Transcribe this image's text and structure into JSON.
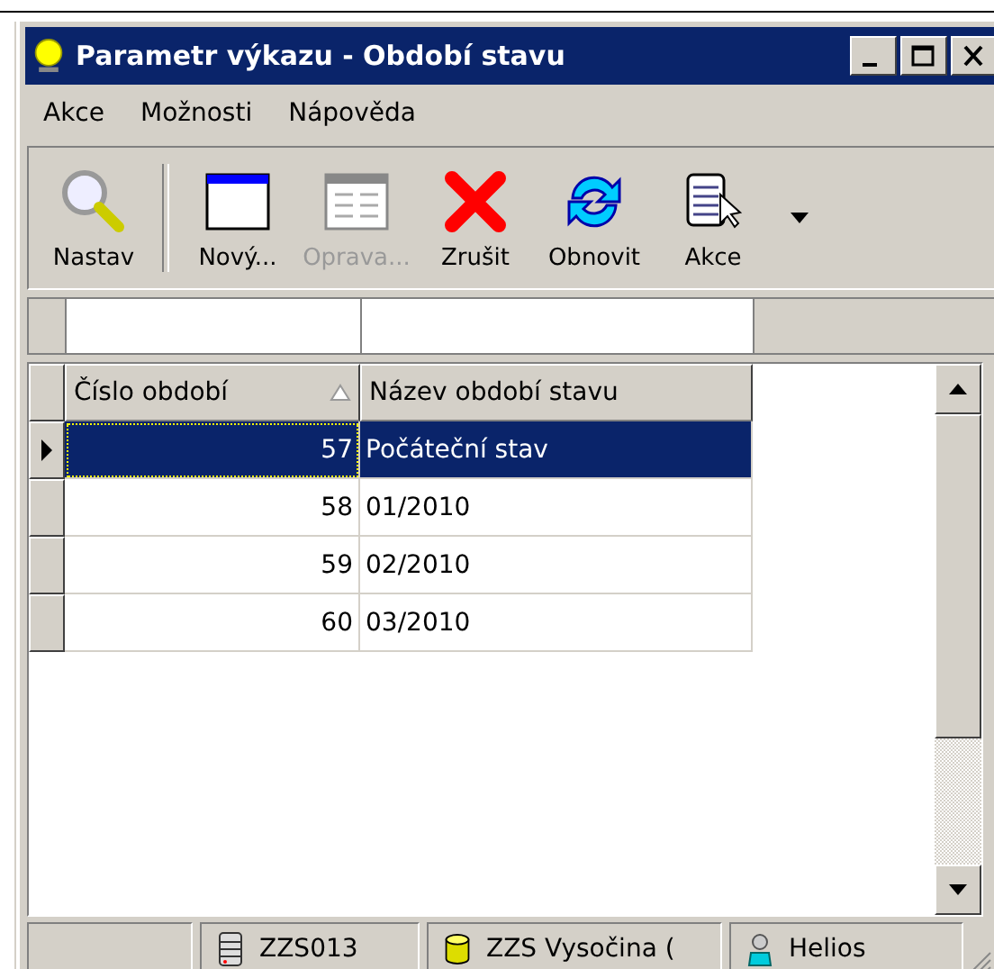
{
  "window": {
    "title": "Parametr výkazu - Období stavu"
  },
  "menu": [
    {
      "label": "Akce"
    },
    {
      "label": "Možnosti"
    },
    {
      "label": "Nápověda"
    }
  ],
  "toolbar": [
    {
      "kind": "search",
      "label": "Nastav",
      "disabled": false
    },
    {
      "kind": "new",
      "label": "Nový...",
      "disabled": false
    },
    {
      "kind": "edit",
      "label": "Oprava...",
      "disabled": true
    },
    {
      "kind": "delete",
      "label": "Zrušit",
      "disabled": false
    },
    {
      "kind": "refresh",
      "label": "Obnovit",
      "disabled": false
    },
    {
      "kind": "actions",
      "label": "Akce",
      "disabled": false
    }
  ],
  "grid": {
    "columns": [
      {
        "label": "Číslo období",
        "sorted": true
      },
      {
        "label": "Název období stavu",
        "sorted": false
      }
    ],
    "rows": [
      {
        "number": "57",
        "name": "Počáteční stav",
        "selected": true
      },
      {
        "number": "58",
        "name": "01/2010",
        "selected": false
      },
      {
        "number": "59",
        "name": "02/2010",
        "selected": false
      },
      {
        "number": "60",
        "name": "03/2010",
        "selected": false
      }
    ]
  },
  "status_bar": [
    {
      "kind": "empty"
    },
    {
      "kind": "server",
      "text": "ZZS013"
    },
    {
      "kind": "database",
      "text": "ZZS Vysočina ("
    },
    {
      "kind": "user",
      "text": "Helios"
    }
  ]
}
